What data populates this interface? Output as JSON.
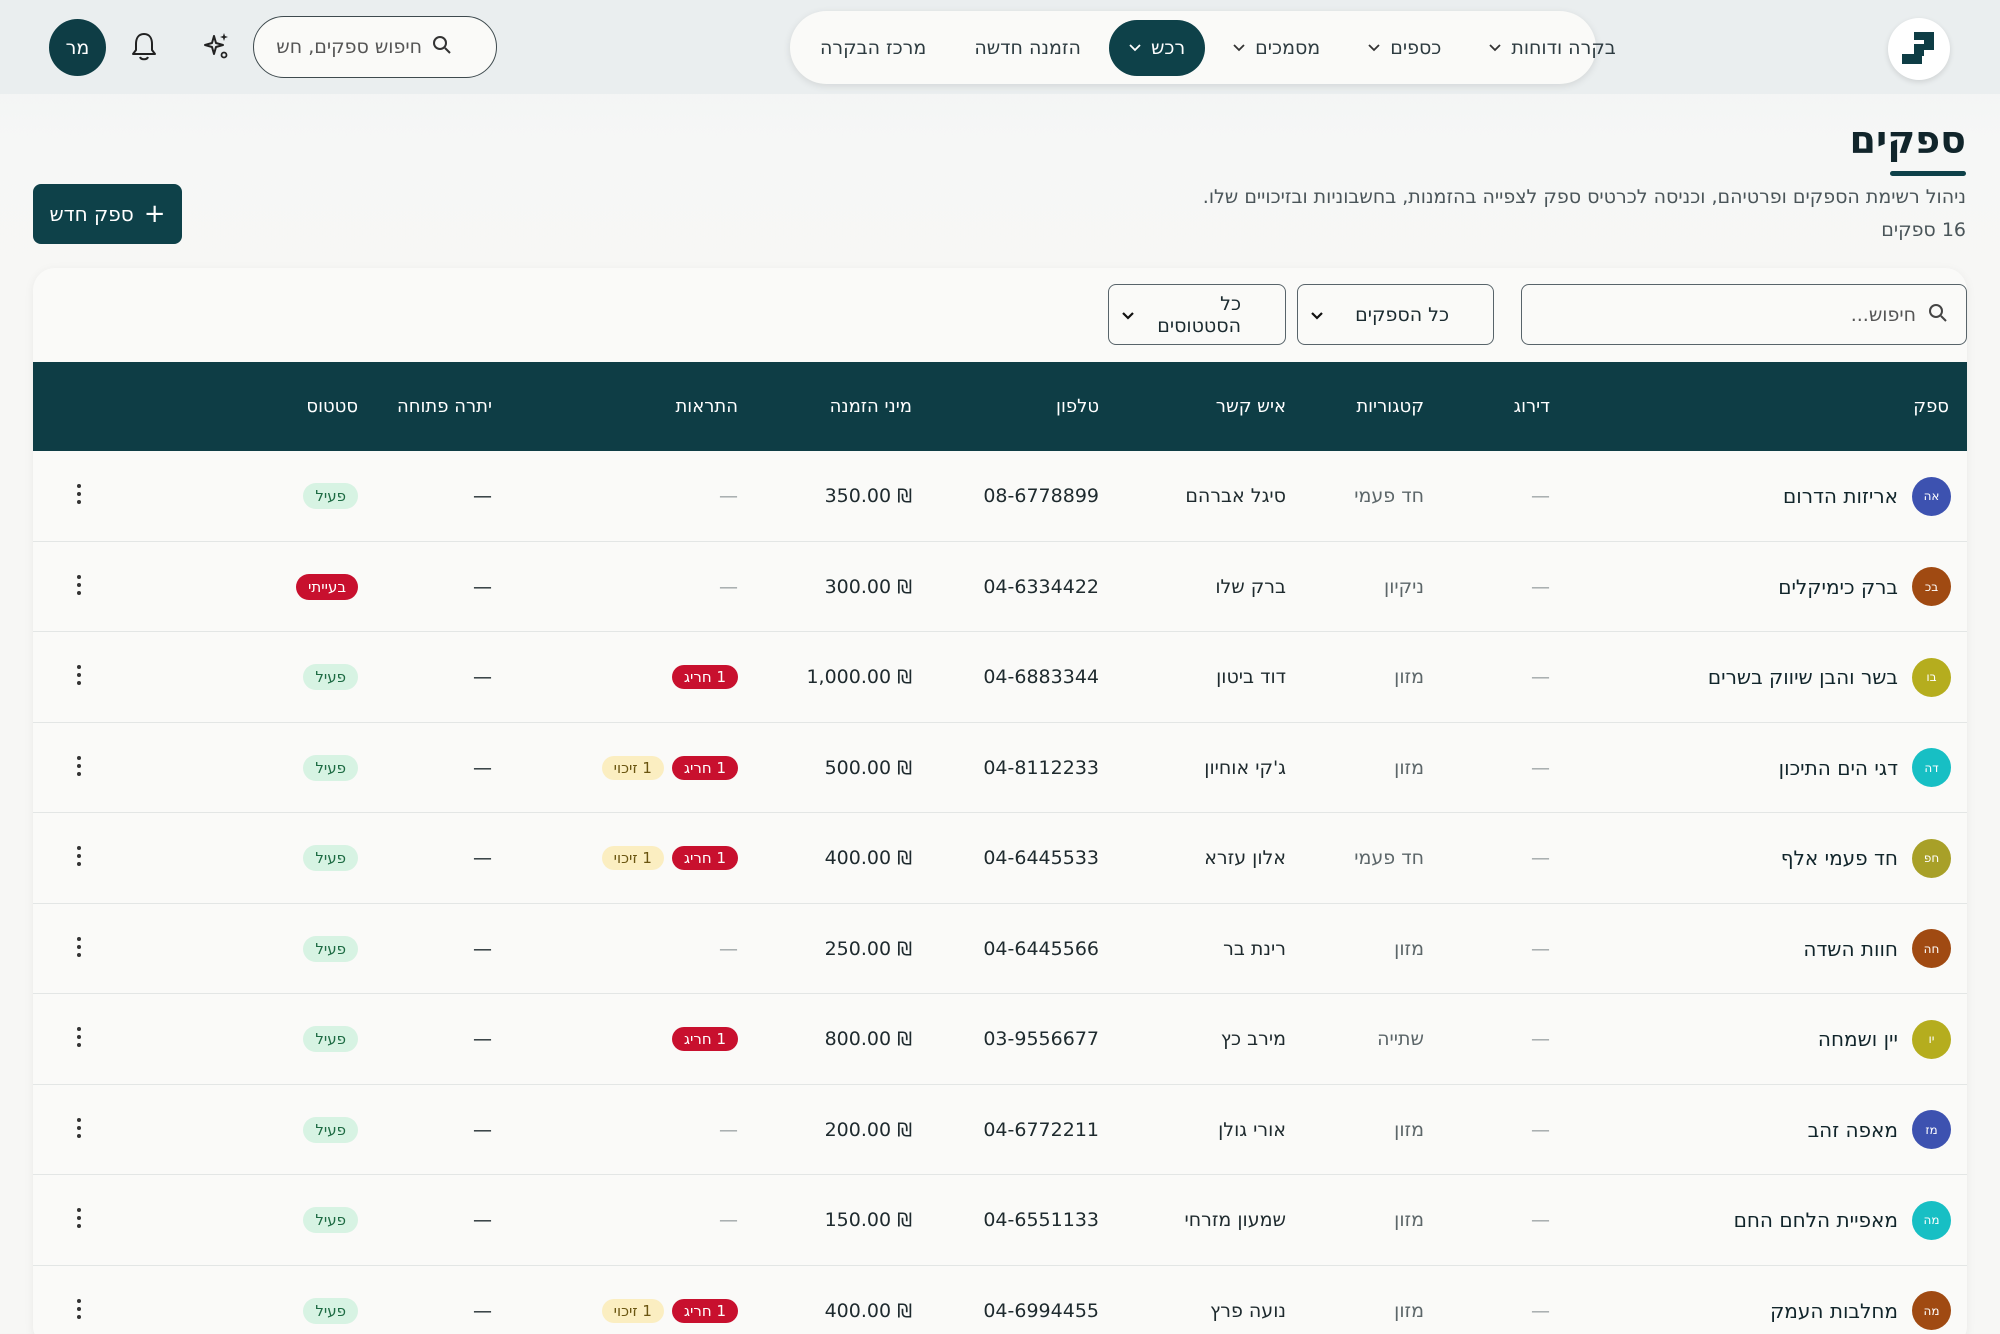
{
  "nav": {
    "items": [
      {
        "label": "מרכז הבקרה",
        "chevron": false,
        "active": false
      },
      {
        "label": "הזמנה חדשה",
        "chevron": false,
        "active": false
      },
      {
        "label": "רכש",
        "chevron": true,
        "active": true
      },
      {
        "label": "מסמכים",
        "chevron": true,
        "active": false
      },
      {
        "label": "כספים",
        "chevron": true,
        "active": false
      },
      {
        "label": "בקרה ודוחות",
        "chevron": true,
        "active": false
      }
    ]
  },
  "top_search": {
    "placeholder": "חיפוש ספקים, חש"
  },
  "user": {
    "initials": "מר"
  },
  "page": {
    "title": "ספקים",
    "description": "ניהול רשימת הספקים ופרטיהם, וכניסה לכרטיס ספק לצפייה בהזמנות, בחשבוניות ובזיכויים שלו.",
    "count": "16 ספקים",
    "new_button": "ספק חדש"
  },
  "filters": {
    "search_placeholder": "חיפוש...",
    "supplier_select": "כל הספקים",
    "status_select": "כל הסטטוסים"
  },
  "table": {
    "headers": {
      "supplier": "ספק",
      "rating": "דירוג",
      "categories": "קטגוריות",
      "contact": "איש קשר",
      "phone": "טלפון",
      "min_order": "מיני הזמנה",
      "alerts": "התראות",
      "open_balance": "יתרה פתוחה",
      "status": "סטטוס"
    },
    "rows": [
      {
        "initials": "אה",
        "color": "#3d52b0",
        "name": "אריזות הדרום",
        "rating": "—",
        "category": "חד פעמי",
        "contact": "סיגל אברהם",
        "phone": "08-6778899",
        "min_order": "₪ 350.00",
        "alert_red": "",
        "alert_yellow": "",
        "balance": "—",
        "status": "פעיל",
        "status_type": "active"
      },
      {
        "initials": "בכ",
        "color": "#a04a12",
        "name": "ברק כימיקלים",
        "rating": "—",
        "category": "ניקיון",
        "contact": "ברק שלו",
        "phone": "04-6334422",
        "min_order": "₪ 300.00",
        "alert_red": "",
        "alert_yellow": "",
        "balance": "—",
        "status": "בעייתי",
        "status_type": "problem"
      },
      {
        "initials": "בו",
        "color": "#b5ad1e",
        "name": "בשר והבן שיווק בשרים",
        "rating": "—",
        "category": "מזון",
        "contact": "דוד ביטון",
        "phone": "04-6883344",
        "min_order": "₪ 1,000.00",
        "alert_red": "1 חריג",
        "alert_yellow": "",
        "balance": "—",
        "status": "פעיל",
        "status_type": "active"
      },
      {
        "initials": "דה",
        "color": "#17bfc4",
        "name": "דגי הים התיכון",
        "rating": "—",
        "category": "מזון",
        "contact": "ג'קי אוחיון",
        "phone": "04-8112233",
        "min_order": "₪ 500.00",
        "alert_red": "1 חריג",
        "alert_yellow": "1 זיכוי",
        "balance": "—",
        "status": "פעיל",
        "status_type": "active"
      },
      {
        "initials": "חפ",
        "color": "#a8a028",
        "name": "חד פעמי אלף",
        "rating": "—",
        "category": "חד פעמי",
        "contact": "אלון עזרא",
        "phone": "04-6445533",
        "min_order": "₪ 400.00",
        "alert_red": "1 חריג",
        "alert_yellow": "1 זיכוי",
        "balance": "—",
        "status": "פעיל",
        "status_type": "active"
      },
      {
        "initials": "חה",
        "color": "#a04a12",
        "name": "חוות השדה",
        "rating": "—",
        "category": "מזון",
        "contact": "רינת בר",
        "phone": "04-6445566",
        "min_order": "₪ 250.00",
        "alert_red": "",
        "alert_yellow": "",
        "balance": "—",
        "status": "פעיל",
        "status_type": "active"
      },
      {
        "initials": "יו",
        "color": "#b5ad1e",
        "name": "יין ושמחה",
        "rating": "—",
        "category": "שתייה",
        "contact": "מירב כץ",
        "phone": "03-9556677",
        "min_order": "₪ 800.00",
        "alert_red": "1 חריג",
        "alert_yellow": "",
        "balance": "—",
        "status": "פעיל",
        "status_type": "active"
      },
      {
        "initials": "מז",
        "color": "#3d52b0",
        "name": "מאפה זהב",
        "rating": "—",
        "category": "מזון",
        "contact": "אורי גולן",
        "phone": "04-6772211",
        "min_order": "₪ 200.00",
        "alert_red": "",
        "alert_yellow": "",
        "balance": "—",
        "status": "פעיל",
        "status_type": "active"
      },
      {
        "initials": "מה",
        "color": "#17bfc4",
        "name": "מאפיית הלחם החם",
        "rating": "—",
        "category": "מזון",
        "contact": "שמעון מזרחי",
        "phone": "04-6551133",
        "min_order": "₪ 150.00",
        "alert_red": "",
        "alert_yellow": "",
        "balance": "—",
        "status": "פעיל",
        "status_type": "active"
      },
      {
        "initials": "מה",
        "color": "#a04a12",
        "name": "מחלבות העמק",
        "rating": "—",
        "category": "מזון",
        "contact": "נועה פרץ",
        "phone": "04-6994455",
        "min_order": "₪ 400.00",
        "alert_red": "1 חריג",
        "alert_yellow": "1 זיכוי",
        "balance": "—",
        "status": "פעיל",
        "status_type": "active"
      }
    ]
  },
  "colors": {
    "brand": "#0e3d45",
    "danger": "#c8102e",
    "success_bg": "#d7f3e3",
    "warning_bg": "#fbeec1"
  },
  "icons": [
    "logo-icon",
    "search-icon",
    "bell-icon",
    "sparkle-icon",
    "plus-icon",
    "chevron-down-icon",
    "kebab-menu-icon"
  ]
}
